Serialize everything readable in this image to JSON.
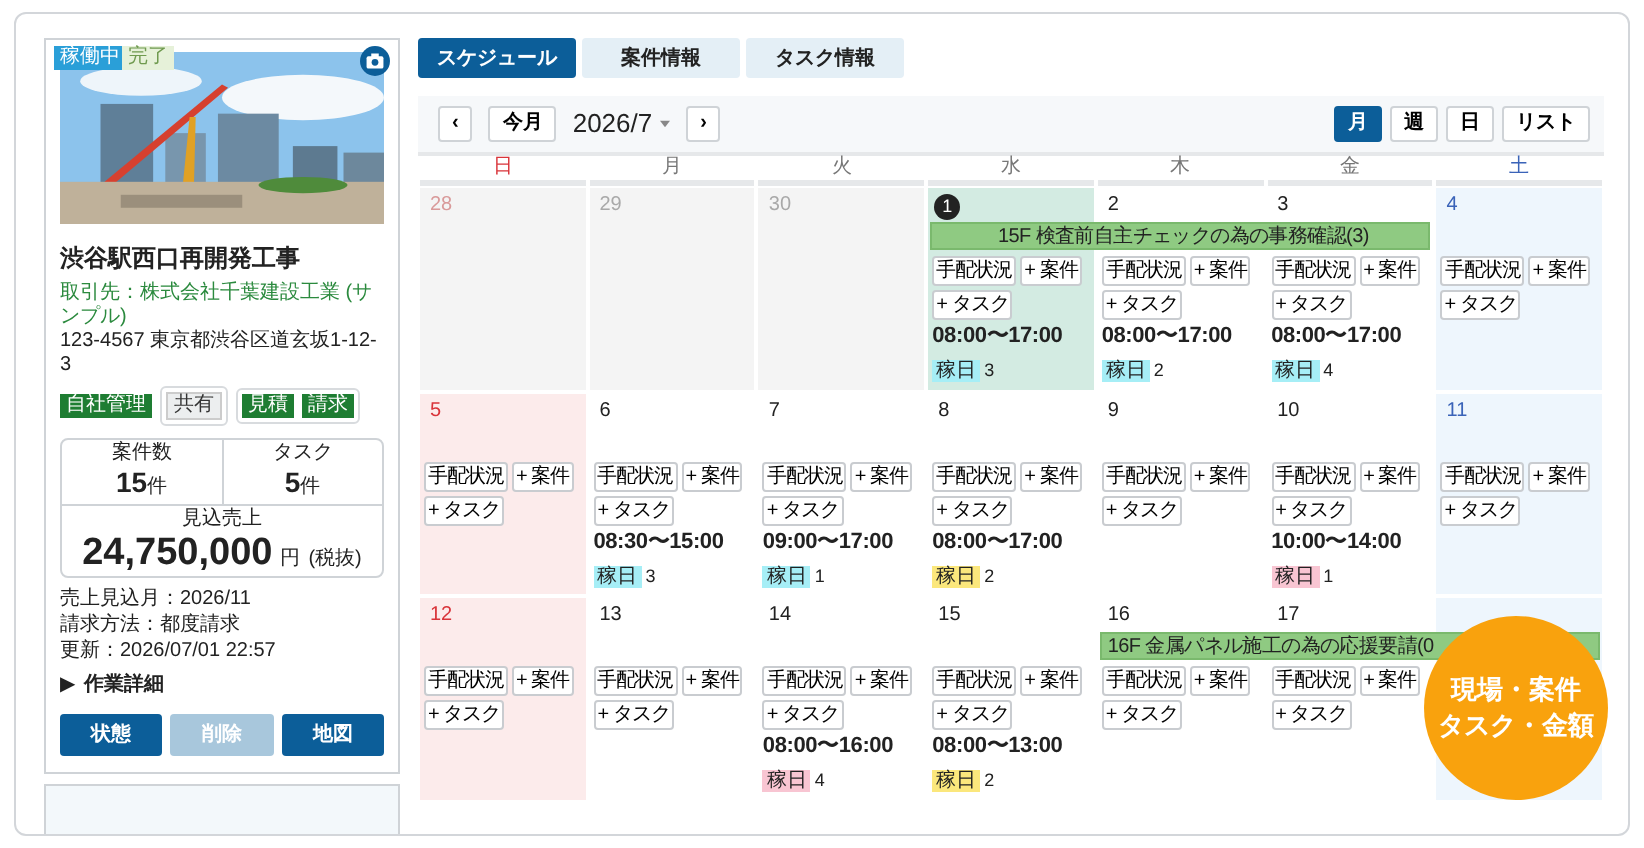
{
  "project_card": {
    "status_badges": [
      {
        "label": "稼働中",
        "active": true
      },
      {
        "label": "完了",
        "active": false
      }
    ],
    "title": "渋谷駅西口再開発工事",
    "client": "取引先：株式会社千葉建設工業 (サンプル)",
    "address": "123-4567 東京都渋谷区道玄坂1-12-3",
    "tags": [
      {
        "label": "自社管理",
        "kind": "solid"
      }
    ],
    "tag_boxes": [
      {
        "tags": [
          {
            "label": "共有",
            "kind": "muted"
          }
        ]
      },
      {
        "tags": [
          {
            "label": "見積",
            "kind": "solid"
          },
          {
            "label": "請求",
            "kind": "solid"
          }
        ]
      }
    ],
    "stats": [
      {
        "label": "案件数",
        "value": "15",
        "unit": "件"
      },
      {
        "label": "タスク",
        "value": "5",
        "unit": "件"
      }
    ],
    "revenue": {
      "label": "見込売上",
      "value": "24,750,000",
      "unit": "円",
      "note": "(税抜)"
    },
    "meta": [
      {
        "label": "売上見込月：",
        "value": "2026/11"
      },
      {
        "label": "請求方法：",
        "value": "都度請求"
      }
    ],
    "updated": "更新：2026/07/01 22:57",
    "details": {
      "marker": "▶",
      "label": "作業詳細"
    },
    "actions": [
      {
        "label": "状態",
        "disabled": false
      },
      {
        "label": "削除",
        "disabled": true
      },
      {
        "label": "地図",
        "disabled": false
      }
    ]
  },
  "tabs": [
    {
      "label": "スケジュール",
      "selected": true
    },
    {
      "label": "案件情報",
      "selected": false
    },
    {
      "label": "タスク情報",
      "selected": false
    }
  ],
  "calendar": {
    "prev": "‹",
    "today_button": "今月",
    "month": "2026/7",
    "next": "›",
    "views": [
      {
        "label": "月",
        "selected": true
      },
      {
        "label": "週",
        "selected": false
      },
      {
        "label": "日",
        "selected": false
      },
      {
        "label": "リスト",
        "selected": false
      }
    ],
    "weekdays": [
      {
        "label": "日",
        "kind": "sunday"
      },
      {
        "label": "月",
        "kind": "weekday"
      },
      {
        "label": "火",
        "kind": "weekday"
      },
      {
        "label": "水",
        "kind": "weekday"
      },
      {
        "label": "木",
        "kind": "weekday"
      },
      {
        "label": "金",
        "kind": "weekday"
      },
      {
        "label": "土",
        "kind": "saturday"
      }
    ],
    "weeks": [
      {
        "days": [
          {
            "day": "28",
            "kind": "other_sunday"
          },
          {
            "day": "29",
            "kind": "other"
          },
          {
            "day": "30",
            "kind": "other"
          },
          {
            "day": "1",
            "kind": "today",
            "event": {
              "label": "15F 検査前自主チェックの為の事務確認(3)"
            },
            "actions": [
              "手配状況",
              "+ 案件",
              "+ タスク"
            ],
            "time": "08:00〜17:00",
            "tag": {
              "label": "稼日",
              "count": "3",
              "color": "#a6eef6"
            }
          },
          {
            "day": "2",
            "kind": "weekday",
            "event_continues": true,
            "actions": [
              "手配状況",
              "+ 案件",
              "+ タスク"
            ],
            "time": "08:00〜17:00",
            "tag": {
              "label": "稼日",
              "count": "2",
              "color": "#a6eef6"
            }
          },
          {
            "day": "3",
            "kind": "weekday",
            "event_continues": true,
            "actions": [
              "手配状況",
              "+ 案件",
              "+ タスク"
            ],
            "time": "08:00〜17:00",
            "tag": {
              "label": "稼日",
              "count": "4",
              "color": "#a6eef6"
            }
          },
          {
            "day": "4",
            "kind": "saturday",
            "actions": [
              "手配状況",
              "+ 案件",
              "+ タスク"
            ]
          }
        ]
      },
      {
        "days": [
          {
            "day": "5",
            "kind": "sunday",
            "actions": [
              "手配状況",
              "+ 案件",
              "+ タスク"
            ]
          },
          {
            "day": "6",
            "kind": "weekday",
            "actions": [
              "手配状況",
              "+ 案件",
              "+ タスク"
            ],
            "time": "08:30〜15:00",
            "tag": {
              "label": "稼日",
              "count": "3",
              "color": "#a6eef6"
            }
          },
          {
            "day": "7",
            "kind": "weekday",
            "actions": [
              "手配状況",
              "+ 案件",
              "+ タスク"
            ],
            "time": "09:00〜17:00",
            "tag": {
              "label": "稼日",
              "count": "1",
              "color": "#a6eef6"
            }
          },
          {
            "day": "8",
            "kind": "weekday",
            "actions": [
              "手配状況",
              "+ 案件",
              "+ タスク"
            ],
            "time": "08:00〜17:00",
            "tag": {
              "label": "稼日",
              "count": "2",
              "color": "#fbe77c"
            }
          },
          {
            "day": "9",
            "kind": "weekday",
            "actions": [
              "手配状況",
              "+ 案件",
              "+ タスク"
            ]
          },
          {
            "day": "10",
            "kind": "weekday",
            "actions": [
              "手配状況",
              "+ 案件",
              "+ タスク"
            ],
            "time": "10:00〜14:00",
            "tag": {
              "label": "稼日",
              "count": "1",
              "color": "#f8c5d2"
            }
          },
          {
            "day": "11",
            "kind": "saturday",
            "actions": [
              "手配状況",
              "+ 案件",
              "+ タスク"
            ]
          }
        ]
      },
      {
        "days": [
          {
            "day": "12",
            "kind": "sunday",
            "actions": [
              "手配状況",
              "+ 案件",
              "+ タスク"
            ]
          },
          {
            "day": "13",
            "kind": "weekday",
            "actions": [
              "手配状況",
              "+ 案件",
              "+ タスク"
            ]
          },
          {
            "day": "14",
            "kind": "weekday",
            "actions": [
              "手配状況",
              "+ 案件",
              "+ タスク"
            ],
            "time": "08:00〜16:00",
            "tag": {
              "label": "稼日",
              "count": "4",
              "color": "#f8c5d2"
            }
          },
          {
            "day": "15",
            "kind": "weekday",
            "actions": [
              "手配状況",
              "+ 案件",
              "+ タスク"
            ],
            "time": "08:00〜13:00",
            "tag": {
              "label": "稼日",
              "count": "2",
              "color": "#fbe77c"
            }
          },
          {
            "day": "16",
            "kind": "weekday",
            "event": {
              "label": "16F 金属パネル施工の為の応援要請(0"
            },
            "actions": [
              "手配状況",
              "+ 案件",
              "+ タスク"
            ]
          },
          {
            "day": "17",
            "kind": "weekday",
            "event_continues": true,
            "actions": [
              "手配状況",
              "+ 案件",
              "+ タスク"
            ]
          },
          {
            "kind": "saturday",
            "event_continues": true
          }
        ]
      }
    ]
  },
  "promo_badge": {
    "lines": [
      "現場・案件",
      "タスク・金額"
    ]
  }
}
